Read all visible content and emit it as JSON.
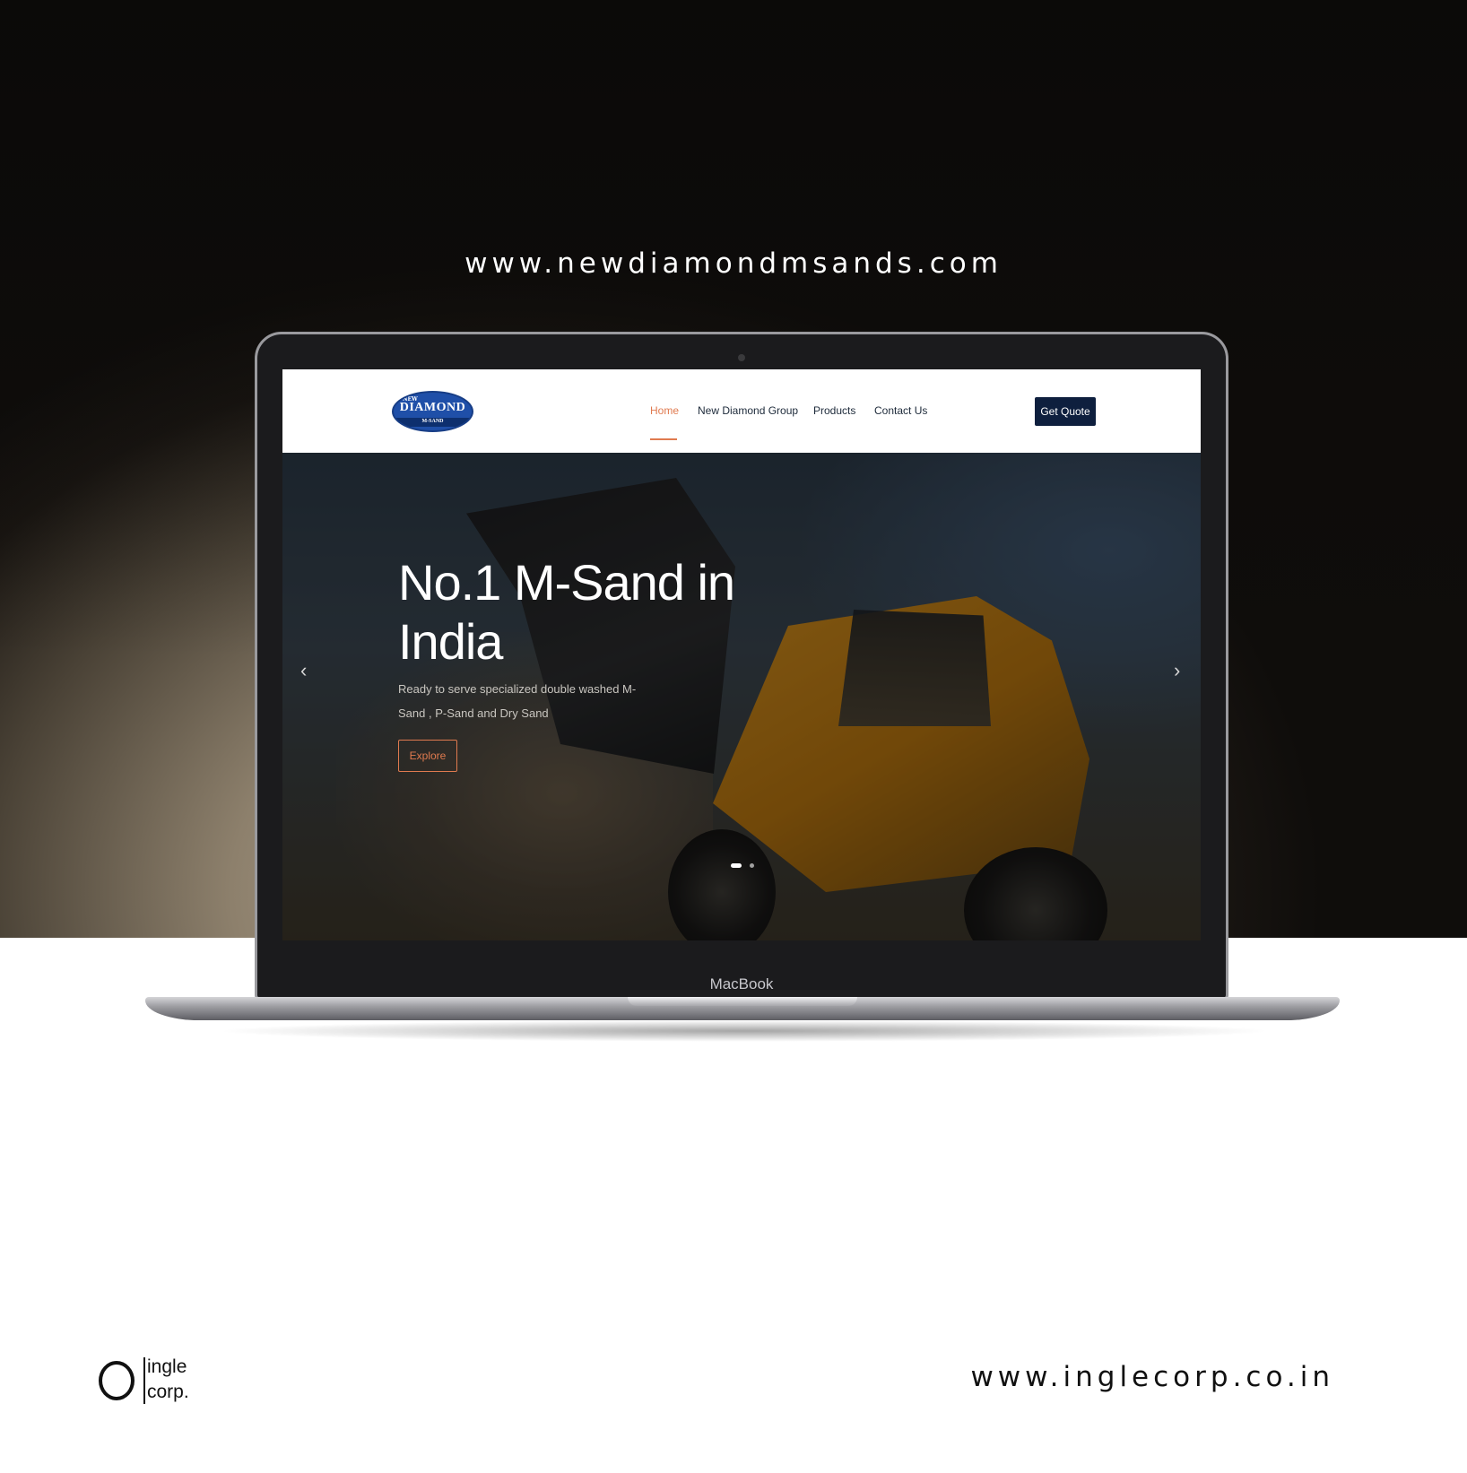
{
  "showcase": {
    "site_url": "www.newdiamondmsands.com",
    "device_label": "MacBook",
    "agency_url": "www.inglecorp.co.in",
    "agency_logo_words": [
      "ingle",
      "corp."
    ]
  },
  "site": {
    "logo": {
      "top_text": "NEW",
      "main_text": "DIAMOND",
      "sub_text": "M-SAND"
    },
    "nav": [
      {
        "label": "Home",
        "active": true
      },
      {
        "label": "New Diamond Group",
        "active": false
      },
      {
        "label": "Products",
        "active": false
      },
      {
        "label": "Contact Us",
        "active": false
      }
    ],
    "cta_label": "Get Quote",
    "hero": {
      "title": "No.1 M-Sand in India",
      "subtitle": "Ready to serve specialized double washed M-Sand , P-Sand and Dry Sand",
      "button_label": "Explore",
      "prev_icon": "chevron-left-icon",
      "next_icon": "chevron-right-icon",
      "slide_count": 2,
      "active_slide": 1
    }
  },
  "colors": {
    "accent": "#e07a4f",
    "navy": "#0e1f3e",
    "logo_blue": "#1f4fa8"
  }
}
